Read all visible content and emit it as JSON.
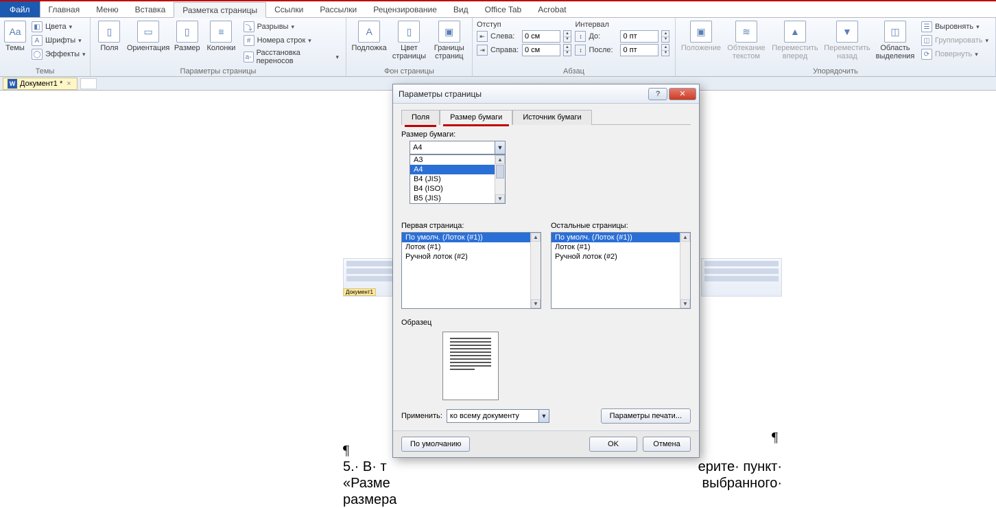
{
  "tabs": {
    "file": "Файл",
    "home": "Главная",
    "menu": "Меню",
    "insert": "Вставка",
    "layout": "Разметка страницы",
    "links": "Ссылки",
    "mailings": "Рассылки",
    "review": "Рецензирование",
    "view": "Вид",
    "officetab": "Office Tab",
    "acrobat": "Acrobat"
  },
  "ribbon": {
    "themes": {
      "themes": "Темы",
      "colors": "Цвета",
      "fonts": "Шрифты",
      "effects": "Эффекты",
      "group": "Темы"
    },
    "page": {
      "margins": "Поля",
      "orient": "Ориентация",
      "size": "Размер",
      "columns": "Колонки",
      "breaks": "Разрывы",
      "linenum": "Номера строк",
      "hyphen": "Расстановка переносов",
      "group": "Параметры страницы"
    },
    "bg": {
      "watermark": "Подложка",
      "color": "Цвет страницы",
      "borders": "Границы страниц",
      "group": "Фон страницы"
    },
    "indent": {
      "title": "Отступ",
      "left": "Слева:",
      "right": "Справа:",
      "left_v": "0 см",
      "right_v": "0 см"
    },
    "spacing": {
      "title": "Интервал",
      "before": "До:",
      "after": "После:",
      "before_v": "0 пт",
      "after_v": "0 пт",
      "group": "Абзац"
    },
    "arrange": {
      "position": "Положение",
      "wrap": "Обтекание текстом",
      "forward": "Переместить вперед",
      "back": "Переместить назад",
      "pane": "Область выделения",
      "align": "Выровнять",
      "grp": "Группировать",
      "rotate": "Повернуть",
      "group": "Упорядочить"
    }
  },
  "doctab": {
    "name": "Документ1 *"
  },
  "dialog": {
    "title": "Параметры страницы",
    "tabs": {
      "margins": "Поля",
      "paper": "Размер бумаги",
      "source": "Источник бумаги"
    },
    "paper_label": "Размер бумаги:",
    "paper_selected": "A4",
    "paper_options": [
      "A3",
      "A4",
      "B4 (JIS)",
      "B4 (ISO)",
      "B5 (JIS)"
    ],
    "first_label": "Первая страница:",
    "other_label": "Остальные страницы:",
    "tray_options": [
      "По умолч. (Лоток (#1))",
      "Лоток (#1)",
      "Ручной лоток (#2)"
    ],
    "sample": "Образец",
    "apply_label": "Применить:",
    "apply_value": "ко всему документу",
    "print_opts": "Параметры печати...",
    "defaults": "По умолчанию",
    "ok": "OK",
    "cancel": "Отмена"
  },
  "doc_text": {
    "p1": "¶",
    "p2_a": "5.·  В·  т",
    "p2_b": "ерите·  пункт·",
    "p3_a": "«Разме",
    "p3_b": "выбранного·",
    "p4": "размера",
    "pil_right": "¶"
  }
}
